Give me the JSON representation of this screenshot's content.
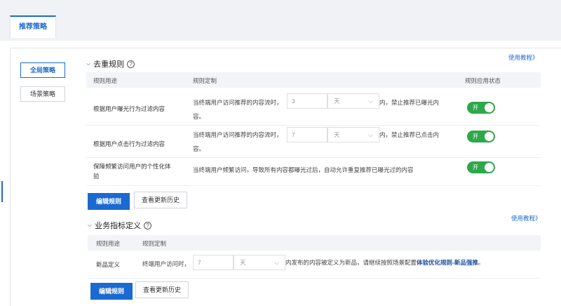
{
  "top_tab": {
    "label": "推荐策略"
  },
  "sidebar": {
    "items": [
      {
        "label": "全局策略"
      },
      {
        "label": "场景策略"
      }
    ]
  },
  "dedup": {
    "title": "去重规则",
    "help": "使用教程》",
    "headers": {
      "purpose": "规则用途",
      "definition": "规则定制",
      "status": "规则应用状态"
    },
    "rows": [
      {
        "purpose": "根据用户曝光行为过滤内容",
        "desc_pre": "当终端用户访问推荐的内容流时，",
        "value": "3",
        "unit": "天",
        "desc_post": "内，禁止推荐已曝光内",
        "desc_line2": "容。",
        "toggle": "开"
      },
      {
        "purpose": "根据用户点击行为过滤内容",
        "desc_pre": "当终端用户访问推荐的内容流时，",
        "value": "7",
        "unit": "天",
        "desc_post": "内，禁止推荐已点击内",
        "desc_line2": "容。",
        "toggle": "开"
      },
      {
        "purpose_line1": "保障频繁访问用户的个性化体",
        "purpose_line2": "验",
        "desc": "当终端用户频繁访问，导致所有内容都曝光过后，自动允许重复推荐已曝光过的内容",
        "toggle": "开"
      }
    ],
    "edit_button": "编辑规则",
    "history_button": "查看更新历史"
  },
  "business": {
    "title": "业务指标定义",
    "help": "使用教程》",
    "headers": {
      "purpose": "规则用途",
      "definition": "规则定制"
    },
    "row": {
      "purpose": "新品定义",
      "desc_pre": "终端用户访问时，",
      "value": "7",
      "unit": "天",
      "desc_post": "内发布的内容被定义为新品，请继续按照场景配置",
      "link": "体验优化规则-新品强推",
      "period": "。"
    },
    "edit_button": "编辑规则",
    "history_button": "查看更新历史"
  }
}
